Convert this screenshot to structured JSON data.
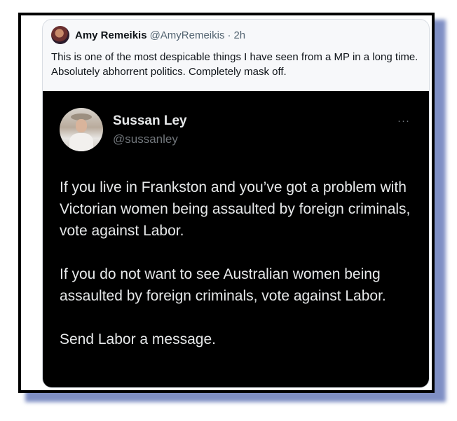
{
  "quoting_tweet": {
    "author_name": "Amy Remeikis",
    "author_handle": "@AmyRemeikis",
    "separator": "·",
    "time": "2h",
    "text": "This is one of the most despicable things I have seen from a MP in a long time.  Absolutely abhorrent politics. Completely mask off."
  },
  "quoted_tweet": {
    "author_name": "Sussan Ley",
    "author_handle": "@sussanley",
    "more_menu": "···",
    "paragraphs": [
      "If you live in Frankston and you’ve got a problem with Victorian women being assaulted by foreign criminals, vote against Labor.",
      "If you do not want to see Australian women being assaulted by foreign criminals, vote against Labor.",
      "Send Labor a message."
    ]
  },
  "colors": {
    "frame_border": "#000000",
    "frame_shadow": "#7f8fc4",
    "quote_card_bg": "#f7f8fa",
    "dark_card_bg": "#000000",
    "dark_text": "#e7e9ea",
    "muted_text": "#71767b"
  }
}
